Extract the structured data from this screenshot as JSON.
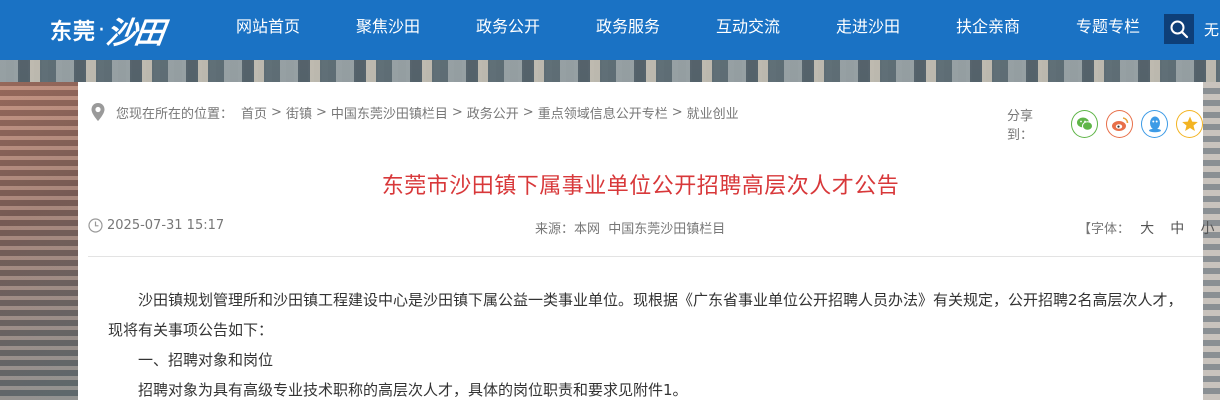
{
  "header": {
    "logo_text": "东莞",
    "logo_script": "沙田",
    "nav": [
      {
        "label": "网站首页"
      },
      {
        "label": "聚焦沙田"
      },
      {
        "label": "政务公开"
      },
      {
        "label": "政务服务"
      },
      {
        "label": "互动交流"
      },
      {
        "label": "走进沙田"
      },
      {
        "label": "扶企亲商"
      },
      {
        "label": "专题专栏"
      }
    ],
    "search_icon": "search-icon",
    "more_label": "无"
  },
  "breadcrumb": {
    "prefix": "您现在所在的位置：",
    "items": [
      "首页",
      "街镇",
      "中国东莞沙田镇栏目",
      "政务公开",
      "重点领域信息公开专栏",
      "就业创业"
    ],
    "separator": ">"
  },
  "share": {
    "label": "分享到：",
    "icons": [
      "wechat-icon",
      "weibo-icon",
      "qq-icon",
      "qzone-icon"
    ],
    "colors": {
      "wechat": "#5fb548",
      "weibo": "#e8704a",
      "qq": "#3d9be6",
      "qzone": "#f3b423"
    }
  },
  "article": {
    "title": "东莞市沙田镇下属事业单位公开招聘高层次人才公告",
    "date": "2025-07-31 15:17",
    "source": "来源：本网  中国东莞沙田镇栏目",
    "font_label": "【字体：",
    "font_large": "大",
    "font_medium": "中",
    "font_small": "小",
    "font_close": "】",
    "paragraphs": [
      "沙田镇规划管理所和沙田镇工程建设中心是沙田镇下属公益一类事业单位。现根据《广东省事业单位公开招聘人员办法》有关规定，公开招聘2名高层次人才，现将有关事项公告如下：",
      "一、招聘对象和岗位",
      "招聘对象为具有高级专业技术职称的高层次人才，具体的岗位职责和要求见附件1。"
    ]
  },
  "colors": {
    "nav_bg": "#1a72c4",
    "title": "#d8383a",
    "search_bg": "#0e3f78"
  }
}
